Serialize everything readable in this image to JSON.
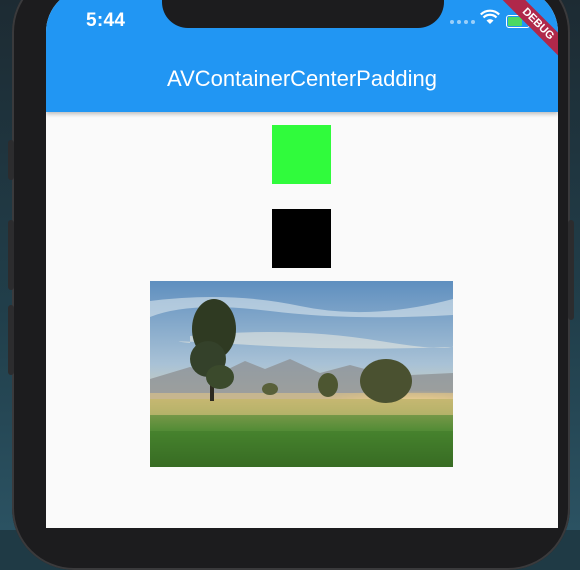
{
  "status_bar": {
    "time": "5:44"
  },
  "app_bar": {
    "title": "AVContainerCenterPadding"
  },
  "debug_banner": {
    "label": "DEBUG"
  },
  "colors": {
    "app_bar": "#2196f3",
    "green_box": "#30fb3c",
    "black_box": "#000000",
    "debug_banner": "#b0284a"
  },
  "icons": [
    "signal-icon",
    "wifi-icon",
    "battery-icon"
  ],
  "content": {
    "image": "landscape-photo"
  }
}
